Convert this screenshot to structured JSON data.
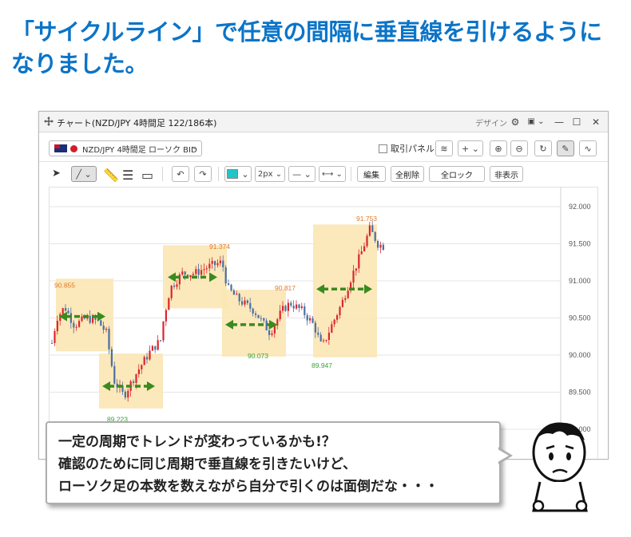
{
  "headline": {
    "line1": "「サイクルライン」で任意の間隔に垂直線を引けるように",
    "line2": "なりました。"
  },
  "window": {
    "title": "チャート(NZD/JPY 4時間足 122/186本)",
    "design_label": "デザイン",
    "symbol_select": "NZD/JPY 4時間足 ローソク BID",
    "order_panel_label": "取引パネル",
    "line_width_value": "2px",
    "color_swatch": "#21c4c7",
    "buttons": {
      "edit": "編集",
      "delete_all": "全削除",
      "lock_all": "全ロック",
      "hide": "非表示"
    }
  },
  "chart_data": {
    "type": "candlestick",
    "y_axis_labels": [
      "92.000",
      "91.500",
      "91.000",
      "90.500",
      "90.000",
      "89.500",
      "89.000"
    ],
    "ylim": [
      88.9,
      92.1
    ],
    "price_labels": [
      {
        "text": "90.855",
        "value": 90.855,
        "kind": "high"
      },
      {
        "text": "89.223",
        "value": 89.223,
        "kind": "low"
      },
      {
        "text": "91.374",
        "value": 91.374,
        "kind": "high"
      },
      {
        "text": "90.073",
        "value": 90.073,
        "kind": "low"
      },
      {
        "text": "90.817",
        "value": 90.817,
        "kind": "high"
      },
      {
        "text": "89.947",
        "value": 89.947,
        "kind": "low"
      },
      {
        "text": "91.753",
        "value": 91.753,
        "kind": "high"
      }
    ],
    "colors": {
      "up": "#d9272c",
      "down": "#4a6fa5",
      "box": "#fbe6b4",
      "arrow": "#3a8a1e",
      "high_label": "#e07a2a",
      "low_label": "#3aa23a"
    }
  },
  "bubble": {
    "line1": "一定の周期でトレンドが変わっているかも!？",
    "line2": "確認のために同じ周期で垂直線を引きたいけど、",
    "line3": "ローソク足の本数を数えながら自分で引くのは面倒だな・・・"
  }
}
